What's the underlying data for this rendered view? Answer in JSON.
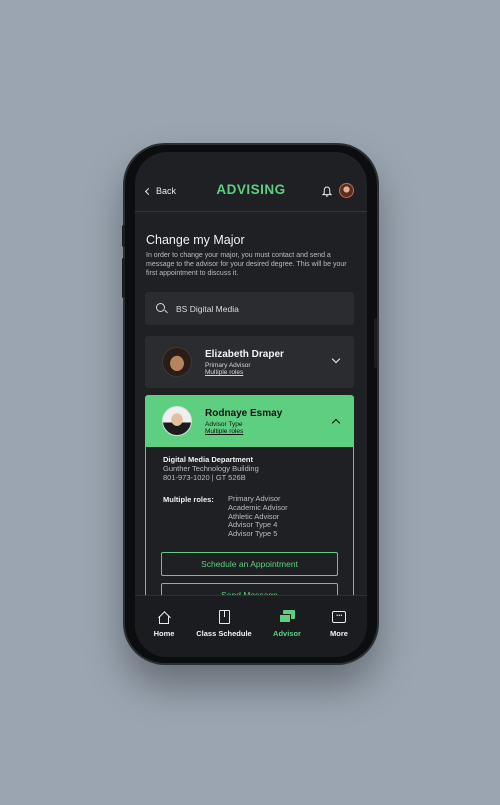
{
  "header": {
    "back_label": "Back",
    "brand": "ADVISING"
  },
  "page": {
    "title": "Change my Major",
    "description": "In order to change your major, you must contact and send a message to the advisor for your desired degree. This will be your first appointment to discuss it."
  },
  "search": {
    "value": "BS Digital Media"
  },
  "advisors": [
    {
      "name": "Elizabeth Draper",
      "type": "Primary Advisor",
      "roles_link": "Multiple roles",
      "expanded": false
    },
    {
      "name": "Rodnaye Esmay",
      "type": "Advisor Type",
      "roles_link": "Multiple roles",
      "expanded": true,
      "department": "Digital Media Department",
      "building": "Gunther Technology Building",
      "contact": "801-973-1020  |  GT 526B",
      "roles_label": "Multiple roles:",
      "roles": [
        "Primary Advisor",
        "Academic Advisor",
        "Athletic Advisor",
        "Advisor Type 4",
        "Advisor Type 5"
      ],
      "schedule_button": "Schedule an Appointment",
      "message_button": "Send Message"
    }
  ],
  "bottom_nav": [
    {
      "label": "Home",
      "icon": "home-icon",
      "active": false
    },
    {
      "label": "Class Schedule",
      "icon": "book-icon",
      "active": false
    },
    {
      "label": "Advisor",
      "icon": "chat-icon",
      "active": true
    },
    {
      "label": "More",
      "icon": "more-icon",
      "active": false
    }
  ],
  "colors": {
    "accent": "#5ecf80",
    "background": "#9aa5b1",
    "screen": "#1f2023",
    "card": "#2b2c30"
  }
}
